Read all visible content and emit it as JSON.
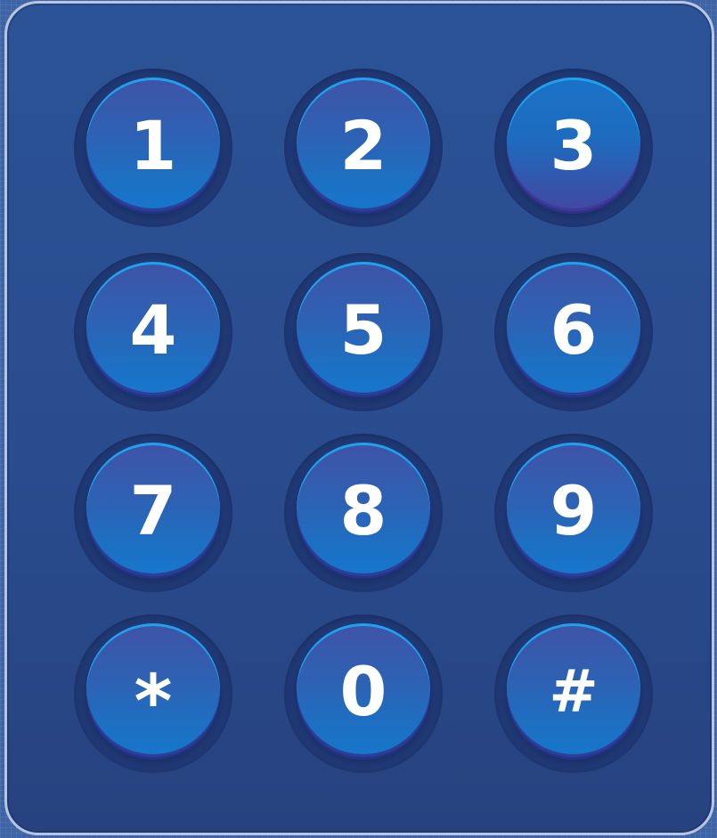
{
  "keypad": {
    "keys": [
      {
        "label": "1"
      },
      {
        "label": "2"
      },
      {
        "label": "3"
      },
      {
        "label": "4"
      },
      {
        "label": "5"
      },
      {
        "label": "6"
      },
      {
        "label": "7"
      },
      {
        "label": "8"
      },
      {
        "label": "9"
      },
      {
        "label": "*"
      },
      {
        "label": "0"
      },
      {
        "label": "#"
      }
    ]
  },
  "colors": {
    "panel": "#2b5396",
    "panel_border": "#b7c6e0",
    "key_top_highlight": "#1ea2ee",
    "key_text": "#ffffff"
  }
}
